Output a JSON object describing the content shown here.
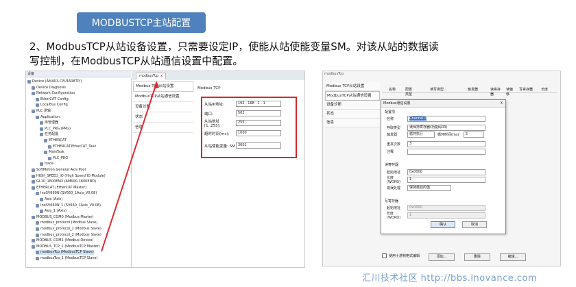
{
  "banner": "MODBUSTCP主站配置",
  "paragraph": "2、ModbusTCP从站设备设置，只需要设定IP，使能从站使能变量SM。对该从站的数据读写控制，在ModbusTCP从站通信设置中配置。",
  "left": {
    "tree_header": "设备",
    "tree": [
      {
        "label": "Device (AM401-CPU1608TP/)",
        "indent": 0
      },
      {
        "label": "Device Diagnosis",
        "indent": 1
      },
      {
        "label": "Network Configuration",
        "indent": 1
      },
      {
        "label": "EtherCAT Config",
        "indent": 2
      },
      {
        "label": "LocalBus Config",
        "indent": 2
      },
      {
        "label": "PLC 逻辑",
        "indent": 1
      },
      {
        "label": "Application",
        "indent": 2
      },
      {
        "label": "库管理器",
        "indent": 3
      },
      {
        "label": "PLC_PRG (PRG)",
        "indent": 3
      },
      {
        "label": "任务配置",
        "indent": 3
      },
      {
        "label": "ETHERCAT",
        "indent": 4
      },
      {
        "label": "ETHERCAT.EtherCAT_Task",
        "indent": 5
      },
      {
        "label": "MainTask",
        "indent": 4
      },
      {
        "label": "PLC_PRG",
        "indent": 5
      },
      {
        "label": "trace",
        "indent": 3
      },
      {
        "label": "SoftMotion General Axis Pool",
        "indent": 1
      },
      {
        "label": "HIGH_SPEED_IO (High Speed IO Module)",
        "indent": 1
      },
      {
        "label": "GL10_1600END (AM600-1600END)",
        "indent": 1
      },
      {
        "label": "ETHERCAT (EtherCAT Master)",
        "indent": 1
      },
      {
        "label": "InoSV660N (SV660_1Axis_V0.08)",
        "indent": 2
      },
      {
        "label": "Axis (Axis)",
        "indent": 3
      },
      {
        "label": "InoSV660N_1 (SV660_1Axis_V0.08)",
        "indent": 2
      },
      {
        "label": "Axis_1 (Axis)",
        "indent": 3
      },
      {
        "label": "MODBUS_COM0 (Modbus Master)",
        "indent": 1
      },
      {
        "label": "modbus_protocol (Modbus Slave)",
        "indent": 2
      },
      {
        "label": "modbus_protocol_1 (Modbus Slave)",
        "indent": 2
      },
      {
        "label": "modbus_protocol_2 (Modbus Slave)",
        "indent": 2
      },
      {
        "label": "MODBUS_COM1 (Modbus Device)",
        "indent": 1
      },
      {
        "label": "MODBUS_TCP_1 (ModbusTCP Master)",
        "indent": 1
      },
      {
        "label": "modbusTcp (ModbusTCP Slave)",
        "indent": 2,
        "selected": true
      },
      {
        "label": "modbusTcp_1 (ModbusTCP Slave)",
        "indent": 2
      }
    ],
    "tab_label": "modbusTcp",
    "tab_close": "x",
    "nav": [
      "Modbus TCP从站设置",
      "ModbusTCP从站通信设置",
      "设备诊断",
      "状态",
      "信息"
    ],
    "form_title": "Modbus TCP",
    "fields": [
      {
        "label": "从站IP地址:",
        "value": "192 . 168 . 1 . 1"
      },
      {
        "label": "端口:",
        "value": "502"
      },
      {
        "label": "从站地址 [1..255]:",
        "value": "255"
      },
      {
        "label": "超时时间(ms):",
        "value": "1000"
      },
      {
        "label": "从站使能变量: SM",
        "value": "3001"
      }
    ]
  },
  "right": {
    "tab": "modbusTcp",
    "nav": [
      "Modbus TCP从站设置",
      "ModbusTCP从站通信设置",
      "设备诊断",
      "状态",
      "信息"
    ],
    "table_headers": [
      "名称",
      "配置类型",
      "读写类型",
      "触发器",
      "读寄存器",
      "读偏移",
      "写寄存器",
      "长度"
    ],
    "dialog": {
      "title": "Modbus通信设置",
      "close": "X",
      "section_general": "配置项",
      "name_label": "名称",
      "name_value": "Channel 0",
      "access_label": "存取类型",
      "access_value": "读保持寄存器(功能码03)",
      "trigger_label": "触发器",
      "trigger_value": "循环执行",
      "cycle_label": "循环时间(ms)",
      "cycle_value": "5",
      "retry_label": "重发次数",
      "retry_value": "3",
      "comment_label": "注释",
      "comment_value": "",
      "read_section": "读寄存器",
      "read_start_label": "起始地址",
      "read_start_value": "0x0000",
      "read_len_label": "长度(WORD)",
      "read_len_value": "1",
      "error_label": "错误处理",
      "error_value": "保持最后的值",
      "write_section": "写寄存器",
      "write_start_label": "起始地址",
      "write_start_value": "0x0000",
      "write_len_label": "长度(WORD)",
      "write_len_value": "1",
      "ok": "确认",
      "cancel": "取消"
    },
    "checkbox_label": "使用十进制格式编辑",
    "add_button": "添加...",
    "delete_button": "删除",
    "edit_button": "编辑..."
  },
  "watermark": "汇川技术社区 http://bbs.inovance.com"
}
